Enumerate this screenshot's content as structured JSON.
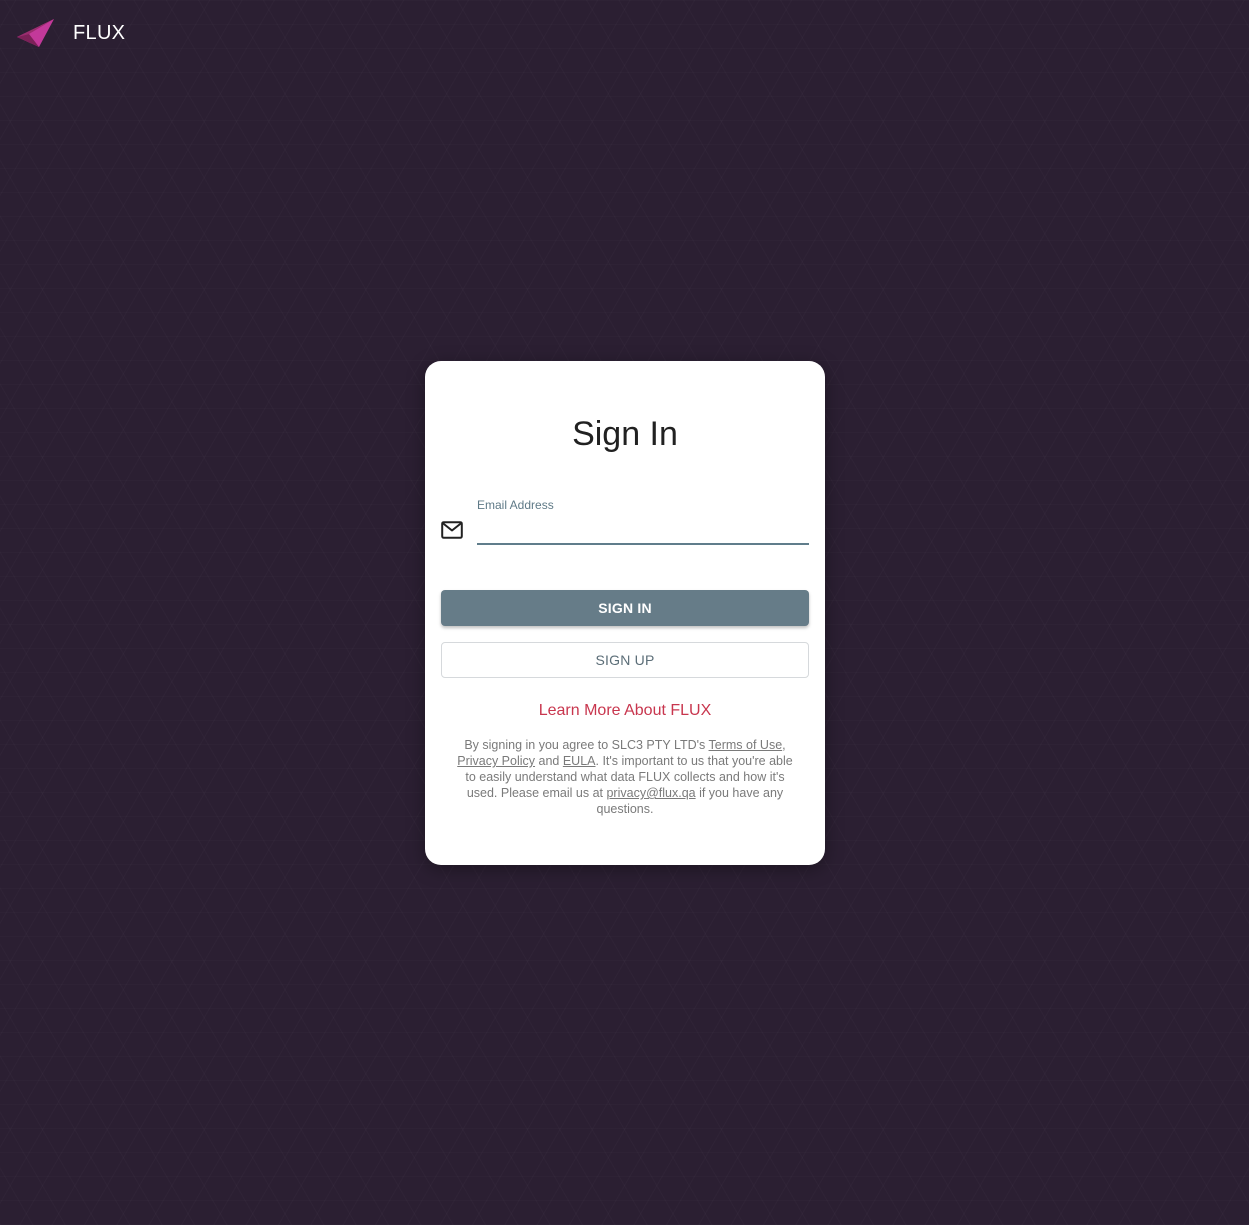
{
  "header": {
    "brand": "FLUX",
    "logo_colors": [
      "#a9386f",
      "#c3399a",
      "#8e2a6e"
    ]
  },
  "card": {
    "title": "Sign In",
    "email": {
      "label": "Email Address",
      "value": "",
      "icon": "mail-icon"
    },
    "sign_in_label": "SIGN IN",
    "sign_up_label": "SIGN UP",
    "learn_more_label": "Learn More About FLUX",
    "legal": {
      "text_1": "By signing in you agree to SLC3 PTY LTD's ",
      "terms_link": "Terms of Use",
      "text_2": ", ",
      "privacy_link": "Privacy Policy",
      "text_3": " and ",
      "eula_link": "EULA",
      "text_4": ". It's important to us that you're able to easily understand what data FLUX collects and how it's used. Please email us at ",
      "email_link": "privacy@flux.qa",
      "text_5": " if you have any questions."
    }
  },
  "colors": {
    "background": "#2b1f32",
    "primary_button": "#667c88",
    "link_accent": "#c8364e"
  }
}
